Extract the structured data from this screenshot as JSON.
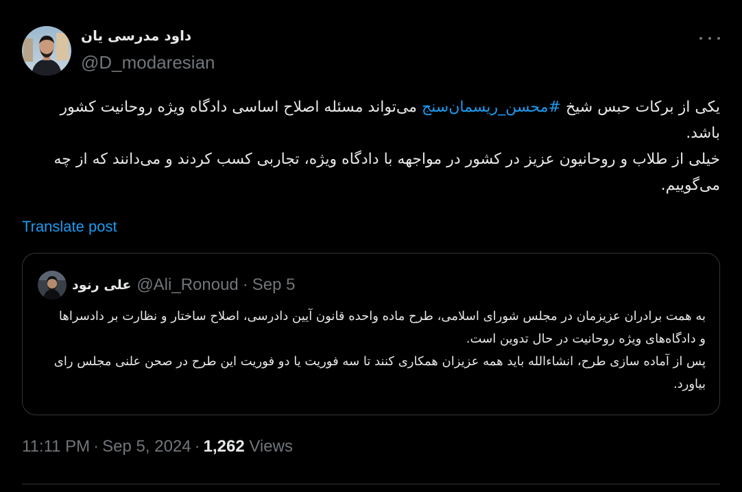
{
  "author": {
    "display_name": "داود مدرسی یان",
    "handle": "@D_modaresian",
    "avatar_icon": "profile-photo"
  },
  "more_icon": "ellipsis-icon",
  "tweet": {
    "line1_before": "یکی از برکات حبس شیخ ",
    "hashtag": "#محسن_ریسمان‌سنج",
    "line1_after": " می‌تواند مسئله اصلاح اساسی دادگاه ویژه روحانیت کشور باشد.",
    "line2": "خیلی از طلاب و روحانیون عزیز در کشور در مواجهه با دادگاه ویژه، تجاربی کسب کردند و می‌دانند که از چه می‌گوییم."
  },
  "translate_label": "Translate post",
  "quote": {
    "author_name": "علی رنود",
    "handle": "@Ali_Ronoud",
    "separator": "·",
    "date": "Sep 5",
    "paragraph1": "به همت برادران عزیزمان در مجلس شورای اسلامی، طرح ماده واحده قانون آیین دادرسی، اصلاح ساختار و نظارت بر دادسراها و دادگاه‌های ویژه روحانیت در حال تدوین است.",
    "paragraph2": "پس از آماده سازی طرح، انشاءالله باید همه عزیزان همکاری کنند تا سه فوریت یا دو فوریت این طرح در صحن علنی مجلس رای بیاورد."
  },
  "meta": {
    "time": "11:11 PM",
    "separator": "·",
    "date": "Sep 5, 2024",
    "views_count": "1,262",
    "views_label": "Views"
  },
  "colors": {
    "background": "#000000",
    "text": "#e7e9ea",
    "muted": "#71767b",
    "link": "#1d9bf0",
    "border": "#333639"
  }
}
